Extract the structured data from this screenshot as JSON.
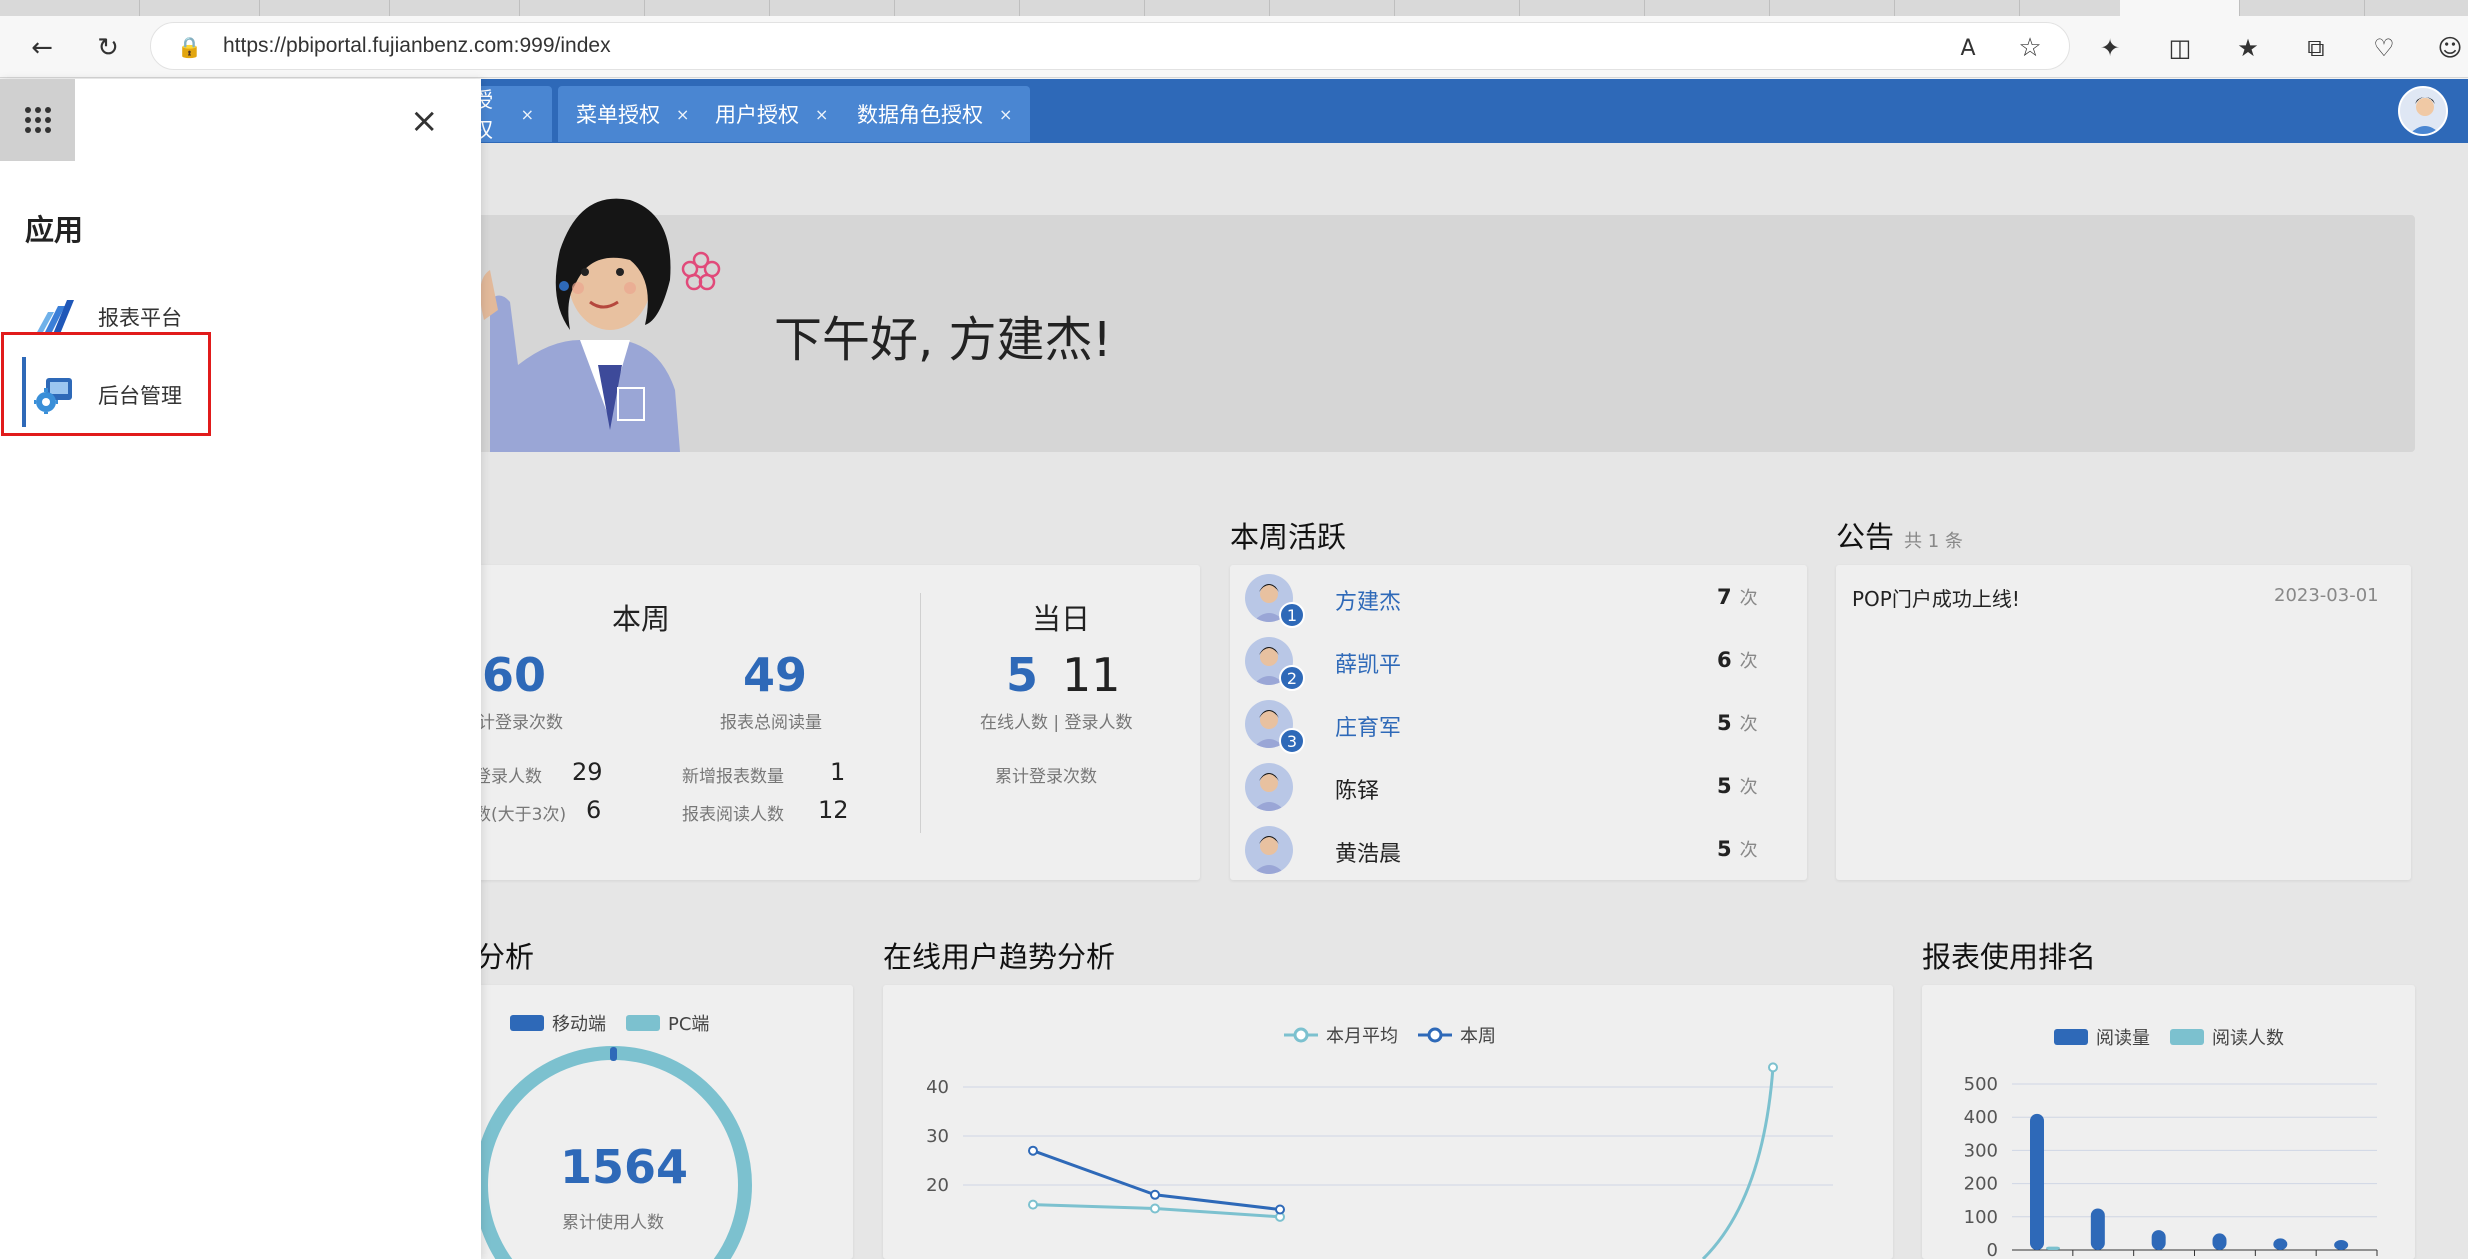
{
  "browser": {
    "url": "https://pbiportal.fujianbenz.com:999/index"
  },
  "app_tabs": [
    {
      "label": "授权"
    },
    {
      "label": "菜单授权"
    },
    {
      "label": "用户授权"
    },
    {
      "label": "数据角色授权"
    }
  ],
  "tab_close": "×",
  "drawer": {
    "title": "应用",
    "items": [
      {
        "label": "报表平台"
      },
      {
        "label": "后台管理"
      }
    ]
  },
  "welcome": {
    "greeting": "下午好, 方建杰!"
  },
  "stats": {
    "week_head": "本周",
    "today_head": "当日",
    "week_login_count": "60",
    "week_login_label": "计登录次数",
    "week_reads": "49",
    "week_reads_label": "报表总阅读量",
    "login_users_label": "登录人数",
    "login_users_value": "29",
    "frequent_label": "数(大于3次)",
    "frequent_value": "6",
    "new_reports_label": "新增报表数量",
    "new_reports_value": "1",
    "report_readers_label": "报表阅读人数",
    "report_readers_value": "12",
    "online_now": "5",
    "login_today": "11",
    "online_label": "在线人数 | 登录人数",
    "cum_login_label": "累计登录次数"
  },
  "activity": {
    "title": "本周活跃",
    "unit": "次",
    "rows": [
      {
        "name": "方建杰",
        "count": "7",
        "rank": "1"
      },
      {
        "name": "薛凯平",
        "count": "6",
        "rank": "2"
      },
      {
        "name": "庄育军",
        "count": "5",
        "rank": "3"
      },
      {
        "name": "陈铎",
        "count": "5",
        "rank": ""
      },
      {
        "name": "黄浩晨",
        "count": "5",
        "rank": ""
      }
    ]
  },
  "notice": {
    "title": "公告",
    "count_text": "共 1 条",
    "items": [
      {
        "text": "POP门户成功上线!",
        "date": "2023-03-01"
      }
    ]
  },
  "device_panel": {
    "title": "分析",
    "legend": [
      "移动端",
      "PC端"
    ],
    "total": "1564",
    "total_label": "累计使用人数",
    "colors": {
      "mobile": "#2e69b8",
      "pc": "#7cc1cf"
    }
  },
  "trend_panel": {
    "title": "在线用户趋势分析"
  },
  "ranking_panel": {
    "title": "报表使用排名"
  },
  "chart_data": [
    {
      "type": "line",
      "legend": [
        "本月平均",
        "本周"
      ],
      "ylim": [
        0,
        50
      ],
      "yticks": [
        "50",
        "40",
        "30",
        "20"
      ],
      "series": [
        {
          "name": "本月平均",
          "color": "#7cc1cf",
          "values": [
            16,
            15.2,
            13.5
          ]
        },
        {
          "name": "本周",
          "color": "#2e69b8",
          "values": [
            27,
            18,
            15
          ]
        }
      ],
      "extra_point": {
        "series": "本月平均",
        "value": 44
      }
    },
    {
      "type": "bar",
      "legend": [
        "阅读量",
        "阅读人数"
      ],
      "ylim": [
        0,
        500
      ],
      "yticks": [
        "500",
        "400",
        "300",
        "200",
        "100",
        "0"
      ],
      "series": [
        {
          "name": "阅读量",
          "color": "#2e69b8",
          "values": [
            410,
            125,
            60,
            50,
            35,
            30
          ]
        },
        {
          "name": "阅读人数",
          "color": "#7cc1cf",
          "values": [
            10,
            0,
            0,
            0,
            0,
            0
          ]
        }
      ]
    }
  ]
}
